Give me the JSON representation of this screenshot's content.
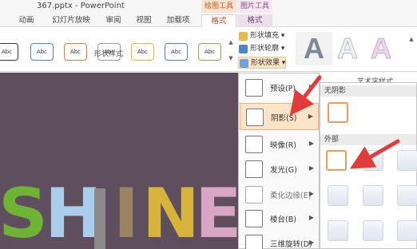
{
  "titlebar": {
    "title": "367.pptx - PowerPoint",
    "ctx_drawing_tools": "绘图工具",
    "ctx_picture_tools": "图片工具"
  },
  "tabs": [
    "动画",
    "幻灯片放映",
    "审阅",
    "视图",
    "加载项",
    "格式",
    "格式"
  ],
  "ribbon": {
    "style_swatch_text": "Abc",
    "swatch_colors": [
      "#333333",
      "#4a87c8",
      "#e07b39",
      "#9a9a9a",
      "#e8b920",
      "#4f7fc5",
      "#7fb24d"
    ],
    "commands": {
      "fill": "形状填充",
      "outline": "形状轮廓",
      "effects": "形状效果"
    },
    "group_shape_styles": "形状样式",
    "group_wordart": "艺术字样式",
    "wordart_letter": "A"
  },
  "slide": {
    "text": "SHINE",
    "background": "#5f4e5e"
  },
  "effects_menu": {
    "items": [
      {
        "label": "预设(P)",
        "state": "normal"
      },
      {
        "label": "阴影(S)",
        "state": "highlight"
      },
      {
        "label": "映像(R)",
        "state": "normal"
      },
      {
        "label": "发光(G)",
        "state": "normal"
      },
      {
        "label": "柔化边缘(E)",
        "state": "disabled"
      },
      {
        "label": "棱台(B)",
        "state": "normal"
      },
      {
        "label": "三维旋转(D)",
        "state": "normal"
      }
    ]
  },
  "shadow_submenu": {
    "no_shadow_header": "无阴影",
    "outer_header": "外部"
  },
  "colors": {
    "accent_highlight": "#fde3c8",
    "annotation_arrow": "#e03c3c",
    "tab_active_text": "#c8461a"
  }
}
